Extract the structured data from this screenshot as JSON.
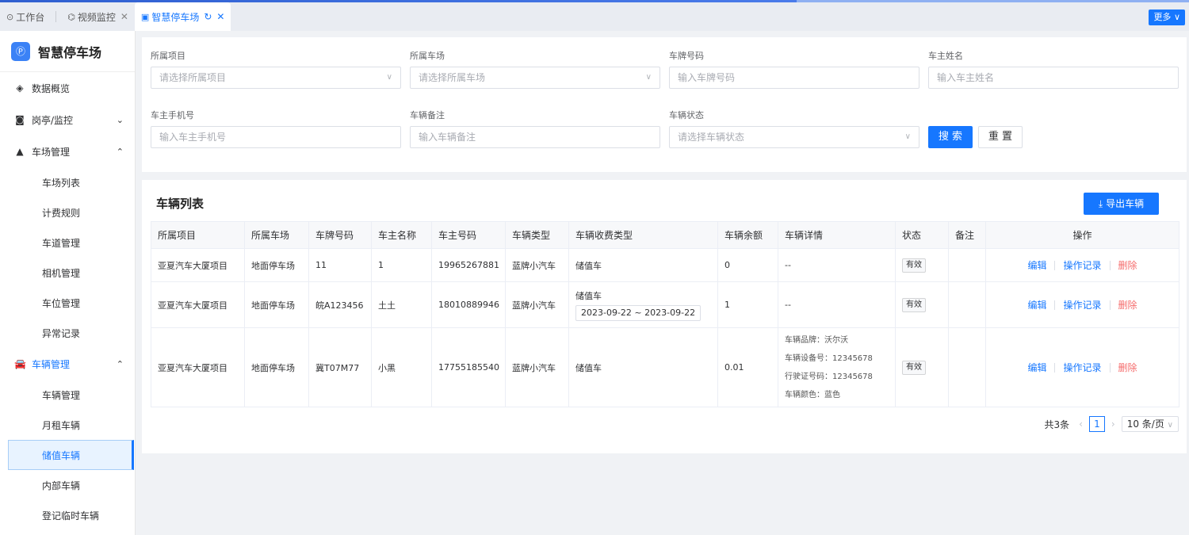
{
  "tabs": {
    "workbench": "工作台",
    "video": "视频监控",
    "parking": "智慧停车场",
    "more": "更多"
  },
  "sidebar": {
    "app_name": "智慧停车场",
    "menu": [
      {
        "label": "数据概览"
      },
      {
        "label": "岗亭/监控"
      },
      {
        "label": "车场管理"
      }
    ],
    "parking_sub": [
      "车场列表",
      "计费规则",
      "车道管理",
      "相机管理",
      "车位管理",
      "异常记录"
    ],
    "vehicle_menu": "车辆管理",
    "vehicle_sub": [
      "车辆管理",
      "月租车辆",
      "储值车辆",
      "内部车辆",
      "登记临时车辆"
    ]
  },
  "form": {
    "project_label": "所属项目",
    "project_placeholder": "请选择所属项目",
    "lot_label": "所属车场",
    "lot_placeholder": "请选择所属车场",
    "plate_label": "车牌号码",
    "plate_placeholder": "输入车牌号码",
    "owner_label": "车主姓名",
    "owner_placeholder": "输入车主姓名",
    "phone_label": "车主手机号",
    "phone_placeholder": "输入车主手机号",
    "remark_label": "车辆备注",
    "remark_placeholder": "输入车辆备注",
    "status_label": "车辆状态",
    "status_placeholder": "请选择车辆状态",
    "search": "搜 索",
    "reset": "重 置"
  },
  "list": {
    "title": "车辆列表",
    "export": "导出车辆",
    "columns": [
      "所属项目",
      "所属车场",
      "车牌号码",
      "车主名称",
      "车主号码",
      "车辆类型",
      "车辆收费类型",
      "车辆余额",
      "车辆详情",
      "状态",
      "备注",
      "操作"
    ],
    "rows": [
      {
        "project": "亚夏汽车大厦项目",
        "lot": "地面停车场",
        "plate": "11",
        "owner": "1",
        "phone": "19965267881",
        "type": "蓝牌小汽车",
        "fee": "储值车",
        "range": "",
        "balance": "0",
        "detail": [
          "--"
        ],
        "status": "有效"
      },
      {
        "project": "亚夏汽车大厦项目",
        "lot": "地面停车场",
        "plate": "皖A123456",
        "owner": "土土",
        "phone": "18010889946",
        "type": "蓝牌小汽车",
        "fee": "储值车",
        "range": "2023-09-22 ~ 2023-09-22",
        "balance": "1",
        "detail": [
          "--"
        ],
        "status": "有效"
      },
      {
        "project": "亚夏汽车大厦项目",
        "lot": "地面停车场",
        "plate": "冀T07M77",
        "owner": "小黑",
        "phone": "17755185540",
        "type": "蓝牌小汽车",
        "fee": "储值车",
        "range": "",
        "balance": "0.01",
        "detail": [
          "车辆品牌：沃尔沃",
          "车辆设备号：12345678",
          "行驶证号码：12345678",
          "车辆颜色：蓝色"
        ],
        "status": "有效"
      }
    ],
    "ops": {
      "edit": "编辑",
      "log": "操作记录",
      "delete": "删除"
    }
  },
  "pager": {
    "total": "共3条",
    "page": "1",
    "size": "10 条/页"
  }
}
